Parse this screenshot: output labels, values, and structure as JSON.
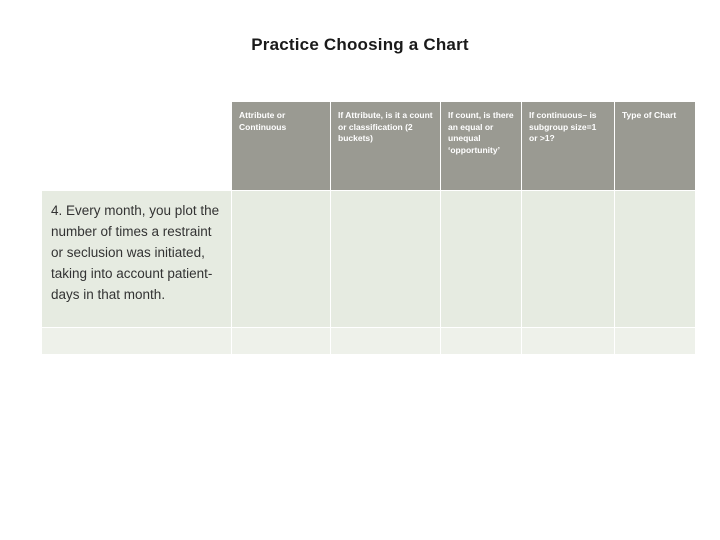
{
  "slide": {
    "title": "Practice Choosing a Chart"
  },
  "table": {
    "headers": [
      "",
      "Attribute or Continuous",
      "If Attribute, is it a count or classification (2 buckets)",
      "If count, is there an equal or unequal ‘opportunity’",
      "If continuous– is subgroup size=1 or >1?",
      "Type of Chart"
    ],
    "rows": [
      {
        "question": "4. Every month, you plot the number of times a restraint or seclusion was initiated, taking into account patient-days in that month.",
        "cells": [
          "",
          "",
          "",
          "",
          ""
        ]
      }
    ],
    "spacer_cells": [
      "",
      "",
      "",
      "",
      "",
      ""
    ]
  }
}
